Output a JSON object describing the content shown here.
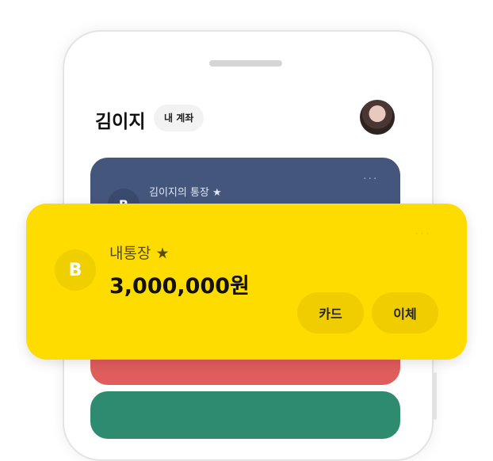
{
  "header": {
    "user_name": "김이지",
    "account_chip": "내 계좌"
  },
  "cards": {
    "secondary": {
      "title": "김이지의 통장 ★",
      "logo_letter": "B",
      "more": "···",
      "color": "#45567c"
    },
    "main": {
      "logo_letter": "B",
      "name": "내통장 ★",
      "balance": "3,000,000원",
      "more": "···",
      "card_button": "카드",
      "transfer_button": "이체",
      "color": "#fedc00"
    },
    "red_color": "#e05d5d",
    "green_color": "#2e8b6f"
  },
  "icons": {
    "avatar": "user-avatar-photo",
    "bank_logo": "b-logo-icon"
  }
}
